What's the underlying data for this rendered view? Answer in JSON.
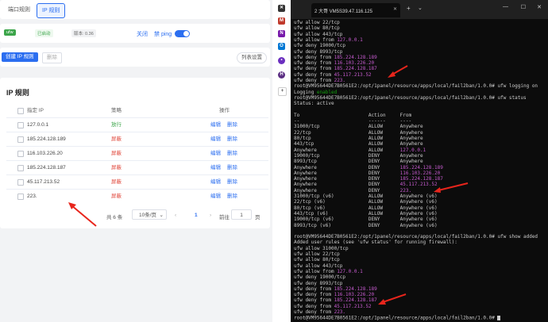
{
  "tabs": [
    "端口规则",
    "IP 规则"
  ],
  "status_bar": {
    "badge": "ufw",
    "state": "已启动",
    "version": "版本: 0.36",
    "close_label": "关闭",
    "ping_label": "禁 ping"
  },
  "toolbar": {
    "create_label": "创建 IP 规则",
    "delete_label": "删除",
    "browse_label": "列表设置"
  },
  "section_title": "IP 规则",
  "table": {
    "headers": [
      "指定 IP",
      "策略",
      "操作"
    ],
    "rows": [
      {
        "ip": "127.0.0.1",
        "policy": "放行",
        "kind": "ok"
      },
      {
        "ip": "185.224.128.189",
        "policy": "屏蔽",
        "kind": "bad"
      },
      {
        "ip": "116.103.226.20",
        "policy": "屏蔽",
        "kind": "bad"
      },
      {
        "ip": "185.224.128.187",
        "policy": "屏蔽",
        "kind": "bad"
      },
      {
        "ip": "45.117.213.52",
        "policy": "屏蔽",
        "kind": "bad"
      },
      {
        "ip": "223.",
        "policy": "屏蔽",
        "kind": "bad"
      }
    ],
    "edit_label": "编辑",
    "delete_label": "删除"
  },
  "pagination": {
    "total": "共 6 条",
    "page_size": "10条/页",
    "current": "1",
    "goto_label": "前往",
    "goto_value": "1",
    "page_unit": "页"
  },
  "terminal": {
    "title": "2 大哥 VM5S39.47.116.125",
    "lines": [
      [
        {
          "t": "ufw allow 22/tcp"
        }
      ],
      [
        {
          "t": "ufw allow 80/tcp"
        }
      ],
      [
        {
          "t": "ufw allow 443/tcp"
        }
      ],
      [
        {
          "t": "ufw allow from "
        },
        {
          "t": "127.0.0.1",
          "c": "mag"
        }
      ],
      [
        {
          "t": "ufw deny 19000/tcp"
        }
      ],
      [
        {
          "t": "ufw deny 8993/tcp"
        }
      ],
      [
        {
          "t": "ufw deny from "
        },
        {
          "t": "185.224.128.189",
          "c": "mag"
        }
      ],
      [
        {
          "t": "ufw deny from "
        },
        {
          "t": "116.103.226.20",
          "c": "mag"
        }
      ],
      [
        {
          "t": "ufw deny from "
        },
        {
          "t": "185.224.128.187",
          "c": "mag"
        }
      ],
      [
        {
          "t": "ufw deny from "
        },
        {
          "t": "45.117.213.52",
          "c": "mag"
        }
      ],
      [
        {
          "t": "ufw deny from "
        },
        {
          "t": "223.",
          "c": "mag"
        }
      ],
      [
        {
          "t": "root@VM95644DE7B0561E2:/opt/1panel/resource/apps/local/fail2ban/1.0.0# ufw logging on"
        }
      ],
      [
        {
          "t": "Logging "
        },
        {
          "t": "enabled",
          "c": "grn"
        }
      ],
      [
        {
          "t": "root@VM95644DE7B0561E2:/opt/1panel/resource/apps/local/fail2ban/1.0.0# ufw status"
        }
      ],
      [
        {
          "t": "Status: active"
        }
      ],
      [
        {
          "t": ""
        }
      ],
      [
        {
          "t": "To                        Action     From"
        }
      ],
      [
        {
          "t": "--                        ------     ----"
        }
      ],
      [
        {
          "t": "31000/tcp                 ALLOW      Anywhere"
        }
      ],
      [
        {
          "t": "22/tcp                    ALLOW      Anywhere"
        }
      ],
      [
        {
          "t": "80/tcp                    ALLOW      Anywhere"
        }
      ],
      [
        {
          "t": "443/tcp                   ALLOW      Anywhere"
        }
      ],
      [
        {
          "t": "Anywhere                  ALLOW      "
        },
        {
          "t": "127.0.0.1",
          "c": "mag"
        }
      ],
      [
        {
          "t": "19000/tcp                 DENY       Anywhere"
        }
      ],
      [
        {
          "t": "8993/tcp                  DENY       Anywhere"
        }
      ],
      [
        {
          "t": "Anywhere                  DENY       "
        },
        {
          "t": "185.224.128.189",
          "c": "mag"
        }
      ],
      [
        {
          "t": "Anywhere                  DENY       "
        },
        {
          "t": "116.103.226.20",
          "c": "mag"
        }
      ],
      [
        {
          "t": "Anywhere                  DENY       "
        },
        {
          "t": "185.224.128.187",
          "c": "mag"
        }
      ],
      [
        {
          "t": "Anywhere                  DENY       "
        },
        {
          "t": "45.117.213.52",
          "c": "mag"
        }
      ],
      [
        {
          "t": "Anywhere                  DENY       "
        },
        {
          "t": "223.",
          "c": "mag"
        }
      ],
      [
        {
          "t": "31000/tcp (v6)            ALLOW      Anywhere (v6)"
        }
      ],
      [
        {
          "t": "22/tcp (v6)               ALLOW      Anywhere (v6)"
        }
      ],
      [
        {
          "t": "80/tcp (v6)               ALLOW      Anywhere (v6)"
        }
      ],
      [
        {
          "t": "443/tcp (v6)              ALLOW      Anywhere (v6)"
        }
      ],
      [
        {
          "t": "19000/tcp (v6)            DENY       Anywhere (v6)"
        }
      ],
      [
        {
          "t": "8993/tcp (v6)             DENY       Anywhere (v6)"
        }
      ],
      [
        {
          "t": ""
        }
      ],
      [
        {
          "t": "root@VM95644DE7B0561E2:/opt/1panel/resource/apps/local/fail2ban/1.0.0# ufw show added"
        }
      ],
      [
        {
          "t": "Added user rules (see 'ufw status' for running firewall):"
        }
      ],
      [
        {
          "t": "ufw allow 31000/tcp"
        }
      ],
      [
        {
          "t": "ufw allow 22/tcp"
        }
      ],
      [
        {
          "t": "ufw allow 80/tcp"
        }
      ],
      [
        {
          "t": "ufw allow 443/tcp"
        }
      ],
      [
        {
          "t": "ufw allow from "
        },
        {
          "t": "127.0.0.1",
          "c": "mag"
        }
      ],
      [
        {
          "t": "ufw deny 19000/tcp"
        }
      ],
      [
        {
          "t": "ufw deny 8993/tcp"
        }
      ],
      [
        {
          "t": "ufw deny from "
        },
        {
          "t": "185.224.128.189",
          "c": "mag"
        }
      ],
      [
        {
          "t": "ufw deny from "
        },
        {
          "t": "116.103.226.20",
          "c": "mag"
        }
      ],
      [
        {
          "t": "ufw deny from "
        },
        {
          "t": "185.224.128.187",
          "c": "mag"
        }
      ],
      [
        {
          "t": "ufw deny from "
        },
        {
          "t": "45.117.213.52",
          "c": "mag"
        }
      ],
      [
        {
          "t": "ufw deny from "
        },
        {
          "t": "223.",
          "c": "mag"
        }
      ],
      [
        {
          "t": "root@VM95644DE7B0561E2:/opt/1panel/resource/apps/local/fail2ban/1.0.0# "
        }
      ]
    ]
  },
  "sidebar_icons": [
    "x-icon",
    "m-icon",
    "onenote-icon",
    "outlook-icon",
    "dot-icon",
    "h-icon"
  ],
  "colors": {
    "accent": "#2b6ef0",
    "allow": "#3ca54a",
    "deny": "#e0483c",
    "terminal_bg": "#0c0c0c",
    "ip_highlight": "#c65bcf",
    "annotation_arrow": "#e8251c"
  }
}
